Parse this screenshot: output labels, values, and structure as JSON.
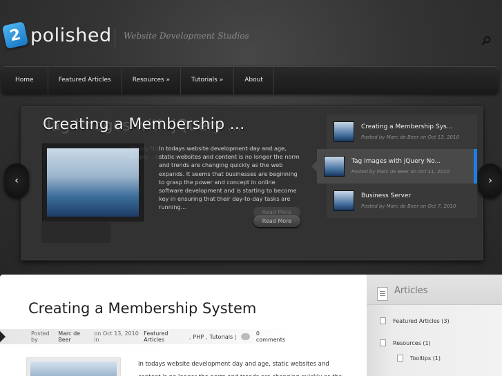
{
  "header": {
    "logo_mark": "2",
    "logo_text": "polished",
    "tagline": "Website Development Studios"
  },
  "nav": {
    "items": [
      "Home",
      "Featured Articles",
      "Resources »",
      "Tutorials »",
      "About"
    ]
  },
  "slider": {
    "title": "Creating a Membership ...",
    "title_ghost": "Tag Images with jQuery ...",
    "excerpt": "In todays website development day and age, static websites and content is no longer the norm and trends are changing quickly as the web expands. It seems that businesses are beginning to grasp the power and concept in online software development and is starting to become key in ensuring that their day-to-day tasks are running...",
    "excerpt_ghost": "jQuery No... allows you... on your own... to the way... in simply... are tied... the users... general...",
    "read_more": "Read More",
    "prev_arrow": "‹",
    "next_arrow": "›",
    "thumbs": [
      {
        "title": "Creating a Membership Sys...",
        "meta": "Posted by Marc de Beer on Oct 13, 2010"
      },
      {
        "title": "Tag Images with jQuery No...",
        "meta": "Posted by Marc de Beer on Oct 11, 2010"
      },
      {
        "title": "Business Server",
        "meta": "Posted by Marc de Beer on Oct 7, 2010"
      }
    ]
  },
  "post": {
    "title": "Creating a Membership System",
    "meta_prefix": "Posted by",
    "author": "Marc de Beer",
    "date_text": "on Oct 13, 2010 in",
    "categories": [
      "Featured Articles",
      "PHP",
      "Tutorials"
    ],
    "comments": "0 comments",
    "excerpt": "In todays website development day and age, static websites and content is no longer the norm and trends are changing quickly as the"
  },
  "sidebar": {
    "title": "Articles",
    "items": [
      {
        "label": "Featured Articles (3)"
      },
      {
        "label": "Resources (1)"
      },
      {
        "label": "Tooltips (1)"
      }
    ]
  }
}
